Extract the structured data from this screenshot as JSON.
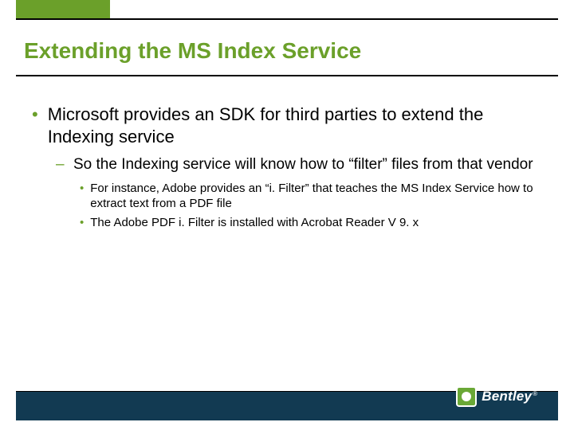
{
  "title": "Extending the MS Index Service",
  "bullets": {
    "lvl1": "Microsoft provides an SDK for third parties to extend the Indexing service",
    "lvl2": "So the Indexing service will know how to “filter” files from that vendor",
    "lvl3a": "For instance, Adobe provides an “i. Filter” that teaches the MS Index Service how to extract text from a PDF file",
    "lvl3b": "The Adobe PDF i. Filter is installed with Acrobat Reader V 9. x"
  },
  "glyphs": {
    "disc": "•",
    "dash": "–"
  },
  "logo": {
    "text": "Bentley",
    "reg": "®"
  }
}
